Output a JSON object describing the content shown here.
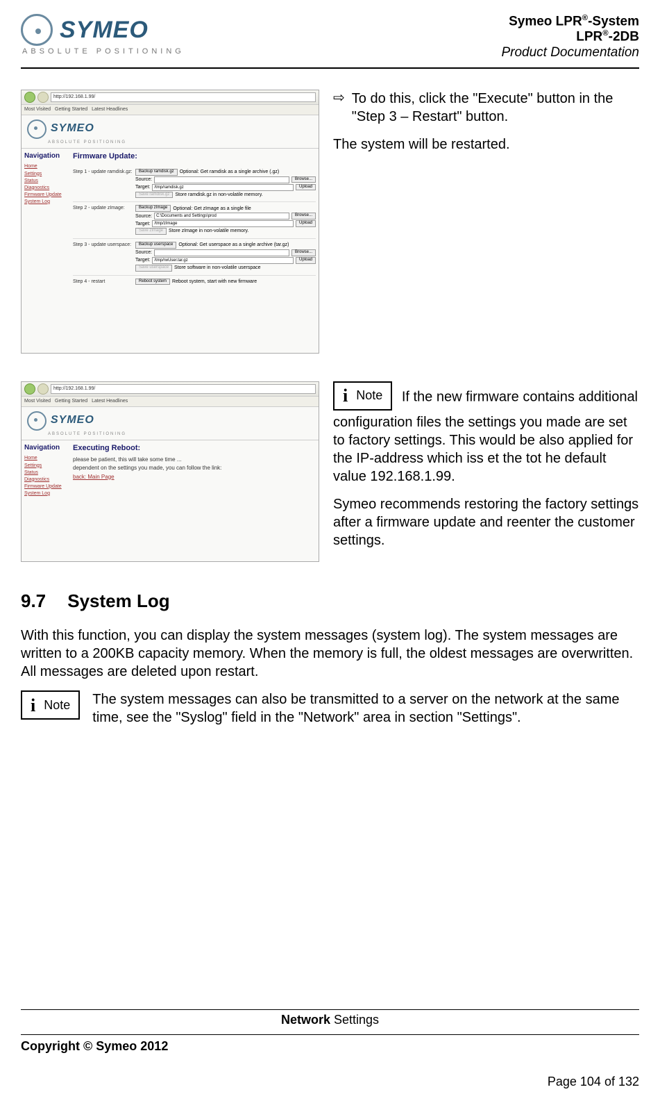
{
  "header": {
    "brand": "SYMEO",
    "brand_sub": "ABSOLUTE POSITIONING",
    "right_line1_a": "Symeo LPR",
    "right_line1_b": "-System",
    "right_line2_a": "LPR",
    "right_line2_b": "-2DB",
    "right_line3": "Product Documentation",
    "sup": "®"
  },
  "screenshot1": {
    "url": "http://192.168.1.99/",
    "bookmarks": [
      "Most Visited",
      "Getting Started",
      "Latest Headlines"
    ],
    "brand": "SYMEO",
    "brand_sub": "ABSOLUTE POSITIONING",
    "nav_title": "Navigation",
    "nav_items": [
      "Home",
      "Settings",
      "Status",
      "Diagnostics",
      "Firmware Update",
      "System Log"
    ],
    "main_title": "Firmware Update:",
    "steps": [
      {
        "label": "Step 1 - update ramdisk.gz:",
        "backup_btn": "Backup ramdisk.gz",
        "backup_opt": "Optional: Get ramdisk as a single archive (.gz)",
        "source": "Source:",
        "browse": "Browse...",
        "target": "Target:",
        "target_val": "/tmp/ramdisk.gz",
        "upload": "Upload",
        "save_btn": "Save ramdisk.gz",
        "save_txt": "Store ramdisk.gz in non-volatile memory."
      },
      {
        "label": "Step 2 - update zImage:",
        "backup_btn": "Backup zImage",
        "backup_opt": "Optional: Get zImage as a single file",
        "source": "Source:",
        "source_val": "C:\\Documents and Settings\\prod",
        "browse": "Browse...",
        "target": "Target:",
        "target_val": "/tmp/zImage",
        "upload": "Upload",
        "save_btn": "Save zImage",
        "save_txt": "Store zImage in non-volatile memory."
      },
      {
        "label": "Step 3 - update userspace:",
        "backup_btn": "Backup userspace",
        "backup_opt": "Optional: Get userspace as a single archive (tar.gz)",
        "source": "Source:",
        "browse": "Browse...",
        "target": "Target:",
        "target_val": "/tmp/rwUser.tar.gz",
        "upload": "Upload",
        "save_btn": "Save userspace",
        "save_txt": "Store software in non-volatile userspace"
      },
      {
        "label": "Step 4 - restart",
        "reboot_btn": "Reboot system",
        "reboot_txt": "Reboot system, start with new firmware"
      }
    ]
  },
  "screenshot2": {
    "url": "http://192.168.1.99/",
    "bookmarks": [
      "Most Visited",
      "Getting Started",
      "Latest Headlines"
    ],
    "brand": "SYMEO",
    "brand_sub": "ABSOLUTE POSITIONING",
    "nav_title": "Navigation",
    "nav_items": [
      "Home",
      "Settings",
      "Status",
      "Diagnostics",
      "Firmware Update",
      "System Log"
    ],
    "main_title": "Executing Reboot:",
    "line1": "please be patient, this will take some time ...",
    "line2": "dependent on the settings you made, you can follow the link:",
    "link": "back: Main Page"
  },
  "content": {
    "bullet1": "To do this, click the \"Execute\" button in the \"Step 3 – Restart\" button.",
    "para1": "The system will be restarted.",
    "note_label": "Note",
    "note1_text1": "If the new firmware contains additional configuration files the settings you made are set to factory settings. This would be also applied for the IP-address which iss et the tot he default value 192.168.1.99.",
    "note1_text2": "Symeo recommends restoring the factory settings after a firmware update and reenter the customer settings.",
    "section_num": "9.7",
    "section_title": "System Log",
    "para2": "With this function, you can display the system messages (system log). The system messages are written to a 200KB capacity memory. When the memory is full, the oldest messages are overwritten. All messages are deleted upon restart.",
    "note2_text": "The system messages can also be transmitted to a server on the network at the same time, see the \"Syslog\" field in the \"Network\" area in section \"Settings\"."
  },
  "footer": {
    "center_bold": "Network",
    "center_rest": " Settings",
    "copyright": "Copyright © Symeo 2012",
    "page": "Page 104 of 132"
  }
}
